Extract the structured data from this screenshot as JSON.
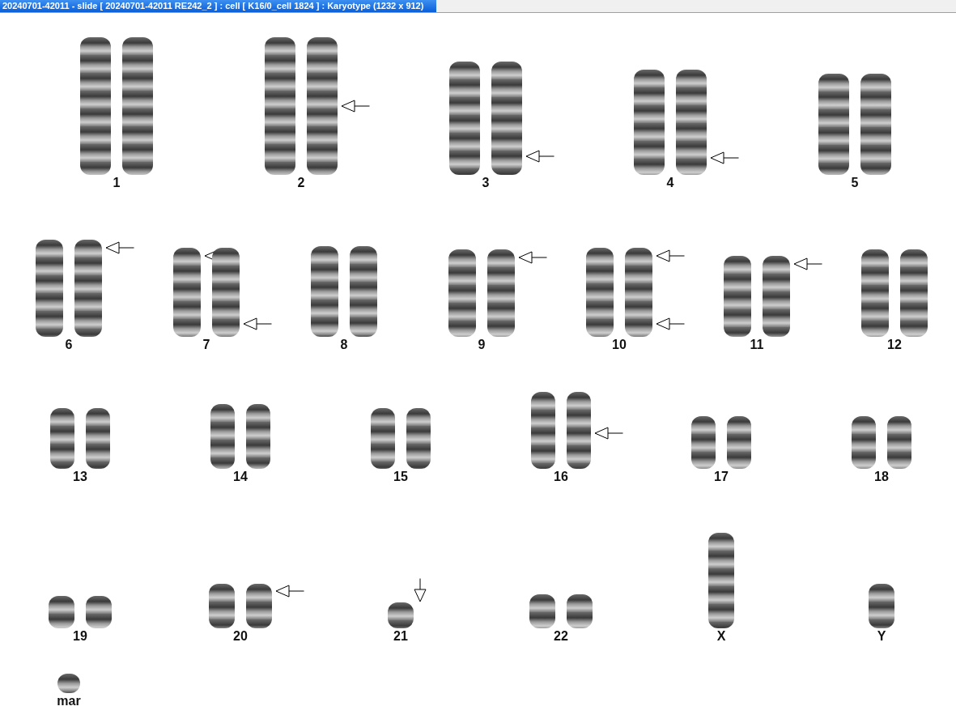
{
  "window": {
    "title": "20240701-42011 - slide [ 20240701-42011 RE242_2 ] : cell [ K16/0_cell 1824 ] : Karyotype  (1232 x 912)"
  },
  "karyotype": {
    "rows": [
      {
        "groups": [
          {
            "label": "1",
            "chromosomes": [
              {
                "marked": false
              },
              {
                "marked": false
              }
            ]
          },
          {
            "label": "2",
            "chromosomes": [
              {
                "marked": false
              },
              {
                "marked": true,
                "arrows": [
                  {
                    "kind": "middle"
                  }
                ]
              }
            ]
          },
          {
            "label": "3",
            "chromosomes": [
              {
                "marked": false
              },
              {
                "marked": true,
                "arrows": [
                  {
                    "kind": "bottom"
                  }
                ]
              }
            ]
          },
          {
            "label": "4",
            "chromosomes": [
              {
                "marked": false
              },
              {
                "marked": true,
                "arrows": [
                  {
                    "kind": "bottom"
                  }
                ]
              }
            ]
          },
          {
            "label": "5",
            "chromosomes": [
              {
                "marked": false
              },
              {
                "marked": false
              }
            ]
          }
        ]
      },
      {
        "groups": [
          {
            "label": "6",
            "chromosomes": [
              {
                "marked": false
              },
              {
                "marked": true,
                "arrows": [
                  {
                    "kind": "top"
                  }
                ]
              }
            ]
          },
          {
            "label": "7",
            "chromosomes": [
              {
                "marked": true,
                "arrows": [
                  {
                    "kind": "top"
                  }
                ]
              },
              {
                "marked": true,
                "arrows": [
                  {
                    "kind": "bottom"
                  }
                ]
              }
            ]
          },
          {
            "label": "8",
            "chromosomes": [
              {
                "marked": false
              },
              {
                "marked": false
              }
            ]
          },
          {
            "label": "9",
            "chromosomes": [
              {
                "marked": false
              },
              {
                "marked": true,
                "arrows": [
                  {
                    "kind": "top"
                  }
                ]
              }
            ]
          },
          {
            "label": "10",
            "chromosomes": [
              {
                "marked": false
              },
              {
                "marked": true,
                "arrows": [
                  {
                    "kind": "top"
                  },
                  {
                    "kind": "bottom"
                  }
                ]
              }
            ]
          },
          {
            "label": "11",
            "chromosomes": [
              {
                "marked": false
              },
              {
                "marked": true,
                "arrows": [
                  {
                    "kind": "top"
                  }
                ]
              }
            ]
          },
          {
            "label": "12",
            "chromosomes": [
              {
                "marked": false
              },
              {
                "marked": false
              }
            ]
          }
        ]
      },
      {
        "groups": [
          {
            "label": "13",
            "chromosomes": [
              {
                "marked": false
              },
              {
                "marked": false
              }
            ]
          },
          {
            "label": "14",
            "chromosomes": [
              {
                "marked": false
              },
              {
                "marked": false
              }
            ]
          },
          {
            "label": "15",
            "chromosomes": [
              {
                "marked": false
              },
              {
                "marked": false
              }
            ]
          },
          {
            "label": "16",
            "chromosomes": [
              {
                "marked": false
              },
              {
                "marked": true,
                "arrows": [
                  {
                    "kind": "middle"
                  }
                ]
              }
            ]
          },
          {
            "label": "17",
            "chromosomes": [
              {
                "marked": false
              },
              {
                "marked": false
              }
            ]
          },
          {
            "label": "18",
            "chromosomes": [
              {
                "marked": false
              },
              {
                "marked": false
              }
            ]
          }
        ]
      },
      {
        "groups": [
          {
            "label": "19",
            "chromosomes": [
              {
                "marked": false
              },
              {
                "marked": false
              }
            ]
          },
          {
            "label": "20",
            "chromosomes": [
              {
                "marked": false
              },
              {
                "marked": true,
                "arrows": [
                  {
                    "kind": "top"
                  }
                ]
              }
            ]
          },
          {
            "label": "21",
            "chromosomes": [
              {
                "marked": true,
                "arrows": [
                  {
                    "kind": "down"
                  }
                ]
              }
            ]
          },
          {
            "label": "22",
            "chromosomes": [
              {
                "marked": false
              },
              {
                "marked": false
              }
            ]
          },
          {
            "label": "X",
            "chromosomes": [
              {
                "marked": false
              }
            ]
          },
          {
            "label": "Y",
            "chromosomes": [
              {
                "marked": false
              }
            ]
          }
        ]
      },
      {
        "groups": [
          {
            "label": "mar",
            "chromosomes": [
              {
                "marked": false
              }
            ]
          }
        ]
      }
    ]
  }
}
